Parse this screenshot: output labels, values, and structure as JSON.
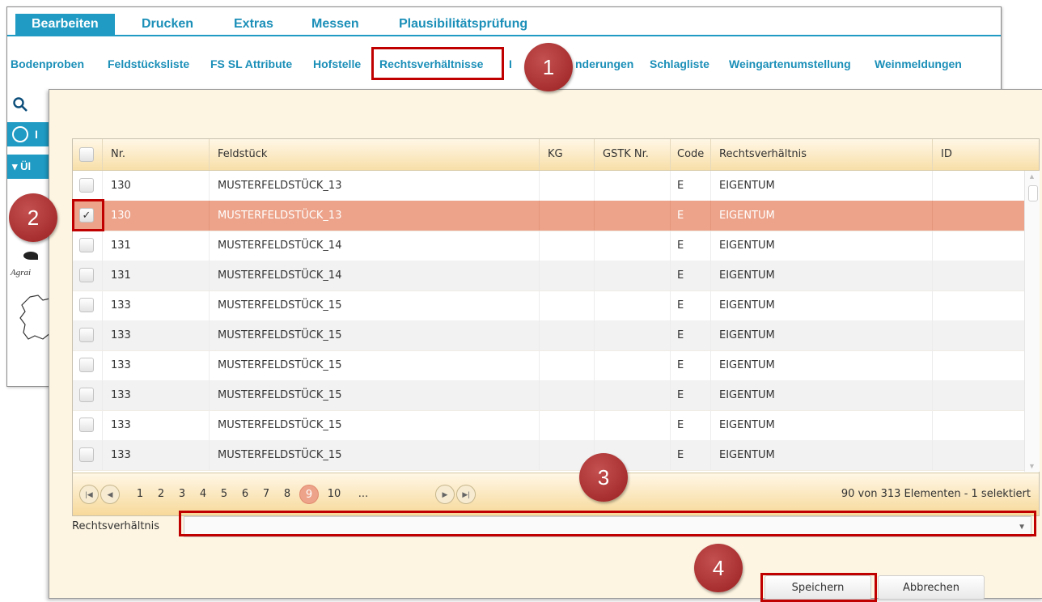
{
  "menu": {
    "tabs": [
      {
        "label": "Bearbeiten"
      },
      {
        "label": "Drucken"
      },
      {
        "label": "Extras"
      },
      {
        "label": "Messen"
      },
      {
        "label": "Plausibilitätsprüfung"
      }
    ],
    "active_tab": "Bearbeiten"
  },
  "subnav": {
    "items": [
      {
        "label": "Bodenproben"
      },
      {
        "label": "Feldstücksliste"
      },
      {
        "label": "FS SL Attribute"
      },
      {
        "label": "Hofstelle"
      },
      {
        "label": "Rechtsverhältnisse"
      },
      {
        "label": "I"
      },
      {
        "label": "nderungen"
      },
      {
        "label": "Schlagliste"
      },
      {
        "label": "Weingartenumstellung"
      },
      {
        "label": "Weinmeldungen"
      }
    ]
  },
  "left_panel": {
    "row1_label": "I",
    "row2_label": "▾ Ül",
    "logo_text": "Agrai"
  },
  "grid": {
    "columns": [
      "Nr.",
      "Feldstück",
      "KG",
      "GSTK Nr.",
      "Code",
      "Rechtsverhältnis",
      "ID"
    ],
    "rows": [
      {
        "nr": "130",
        "feldstueck": "MUSTERFELDSTÜCK_13",
        "kg": "",
        "gstk": "",
        "code": "E",
        "rechtsverhaeltnis": "EIGENTUM",
        "id": "",
        "checked": false
      },
      {
        "nr": "130",
        "feldstueck": "MUSTERFELDSTÜCK_13",
        "kg": "",
        "gstk": "",
        "code": "E",
        "rechtsverhaeltnis": "EIGENTUM",
        "id": "",
        "checked": true
      },
      {
        "nr": "131",
        "feldstueck": "MUSTERFELDSTÜCK_14",
        "kg": "",
        "gstk": "",
        "code": "E",
        "rechtsverhaeltnis": "EIGENTUM",
        "id": "",
        "checked": false
      },
      {
        "nr": "131",
        "feldstueck": "MUSTERFELDSTÜCK_14",
        "kg": "",
        "gstk": "",
        "code": "E",
        "rechtsverhaeltnis": "EIGENTUM",
        "id": "",
        "checked": false
      },
      {
        "nr": "133",
        "feldstueck": "MUSTERFELDSTÜCK_15",
        "kg": "",
        "gstk": "",
        "code": "E",
        "rechtsverhaeltnis": "EIGENTUM",
        "id": "",
        "checked": false
      },
      {
        "nr": "133",
        "feldstueck": "MUSTERFELDSTÜCK_15",
        "kg": "",
        "gstk": "",
        "code": "E",
        "rechtsverhaeltnis": "EIGENTUM",
        "id": "",
        "checked": false
      },
      {
        "nr": "133",
        "feldstueck": "MUSTERFELDSTÜCK_15",
        "kg": "",
        "gstk": "",
        "code": "E",
        "rechtsverhaeltnis": "EIGENTUM",
        "id": "",
        "checked": false
      },
      {
        "nr": "133",
        "feldstueck": "MUSTERFELDSTÜCK_15",
        "kg": "",
        "gstk": "",
        "code": "E",
        "rechtsverhaeltnis": "EIGENTUM",
        "id": "",
        "checked": false
      },
      {
        "nr": "133",
        "feldstueck": "MUSTERFELDSTÜCK_15",
        "kg": "",
        "gstk": "",
        "code": "E",
        "rechtsverhaeltnis": "EIGENTUM",
        "id": "",
        "checked": false
      },
      {
        "nr": "133",
        "feldstueck": "MUSTERFELDSTÜCK_15",
        "kg": "",
        "gstk": "",
        "code": "E",
        "rechtsverhaeltnis": "EIGENTUM",
        "id": "",
        "checked": false
      }
    ]
  },
  "pager": {
    "pages": [
      "1",
      "2",
      "3",
      "4",
      "5",
      "6",
      "7",
      "8",
      "9",
      "10",
      "..."
    ],
    "current_page": "9",
    "info": "90 von 313 Elementen - 1 selektiert"
  },
  "form": {
    "rechtsverhaeltnis_label": "Rechtsverhältnis",
    "rechtsverhaeltnis_value": ""
  },
  "buttons": {
    "save": "Speichern",
    "cancel": "Abbrechen"
  },
  "annotations": [
    "1",
    "2",
    "3",
    "4"
  ],
  "colors": {
    "accent": "#1f9bc4",
    "selected_row": "#eca38a",
    "highlight": "#c00000",
    "badge": "#a52a2a"
  }
}
